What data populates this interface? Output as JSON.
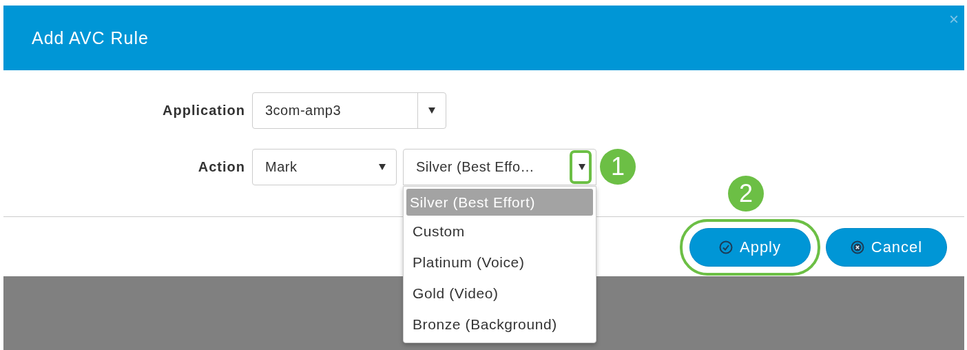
{
  "dialog": {
    "title": "Add AVC Rule",
    "close": "×"
  },
  "fields": [
    {
      "label": "Application",
      "selects": [
        {
          "kind": "split",
          "value": "3com-amp3",
          "open": false
        }
      ]
    },
    {
      "label": "Action",
      "selects": [
        {
          "kind": "plain",
          "value": "Mark",
          "open": false
        },
        {
          "kind": "plain",
          "value": "Silver (Best Effo…",
          "open": true,
          "callout": "1",
          "options": [
            {
              "label": "Silver (Best Effort)",
              "selected": true
            },
            {
              "label": "Custom",
              "selected": false
            },
            {
              "label": "Platinum (Voice)",
              "selected": false
            },
            {
              "label": "Gold (Video)",
              "selected": false
            },
            {
              "label": "Bronze (Background)",
              "selected": false
            }
          ]
        }
      ]
    }
  ],
  "buttons": [
    {
      "kind": "check",
      "label": "Apply",
      "callout": "2"
    },
    {
      "kind": "cancel",
      "label": "Cancel"
    }
  ]
}
